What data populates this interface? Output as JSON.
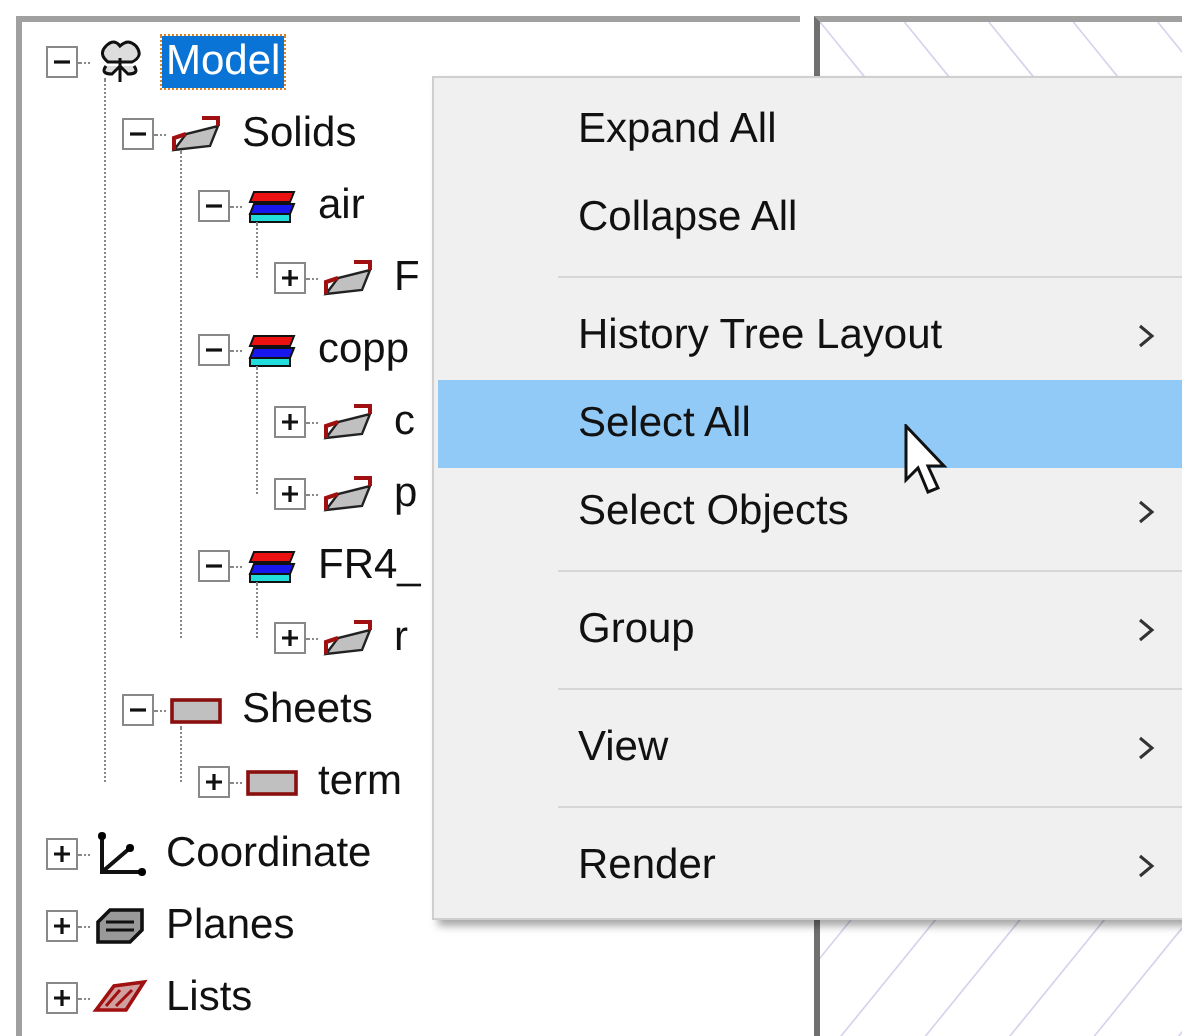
{
  "tree": [
    {
      "label": "Model",
      "kind": "model",
      "expanded": true,
      "selected": true,
      "children": [
        {
          "label": "Solids",
          "kind": "solid",
          "expanded": true,
          "selected": false,
          "children": [
            {
              "label": "air",
              "kind": "material",
              "expanded": true,
              "selected": false,
              "children": [
                {
                  "label": "F",
                  "kind": "solid",
                  "expanded": false,
                  "selected": false
                }
              ]
            },
            {
              "label": "copp",
              "kind": "material",
              "expanded": true,
              "selected": false,
              "children": [
                {
                  "label": "c",
                  "kind": "solid",
                  "expanded": false,
                  "selected": false
                },
                {
                  "label": "p",
                  "kind": "solid",
                  "expanded": false,
                  "selected": false
                }
              ]
            },
            {
              "label": "FR4_",
              "kind": "material",
              "expanded": true,
              "selected": false,
              "children": [
                {
                  "label": "r",
                  "kind": "solid",
                  "expanded": false,
                  "selected": false
                }
              ]
            }
          ]
        },
        {
          "label": "Sheets",
          "kind": "sheet",
          "expanded": true,
          "selected": false,
          "children": [
            {
              "label": "term",
              "kind": "sheet",
              "expanded": false,
              "selected": false
            }
          ]
        }
      ]
    },
    {
      "label": "Coordinate",
      "kind": "axes",
      "expanded": false,
      "selected": false
    },
    {
      "label": "Planes",
      "kind": "planes",
      "expanded": false,
      "selected": false
    },
    {
      "label": "Lists",
      "kind": "lists",
      "expanded": false,
      "selected": false
    }
  ],
  "context_menu": [
    {
      "kind": "item",
      "label": "Expand All",
      "submenu": false,
      "selected": false
    },
    {
      "kind": "item",
      "label": "Collapse All",
      "submenu": false,
      "selected": false
    },
    {
      "kind": "separator"
    },
    {
      "kind": "item",
      "label": "History Tree Layout",
      "submenu": true,
      "selected": false
    },
    {
      "kind": "item",
      "label": "Select All",
      "submenu": false,
      "selected": true
    },
    {
      "kind": "item",
      "label": "Select Objects",
      "submenu": true,
      "selected": false
    },
    {
      "kind": "separator"
    },
    {
      "kind": "item",
      "label": "Group",
      "submenu": true,
      "selected": false
    },
    {
      "kind": "separator"
    },
    {
      "kind": "item",
      "label": "View",
      "submenu": true,
      "selected": false
    },
    {
      "kind": "separator"
    },
    {
      "kind": "item",
      "label": "Render",
      "submenu": true,
      "selected": false
    }
  ]
}
